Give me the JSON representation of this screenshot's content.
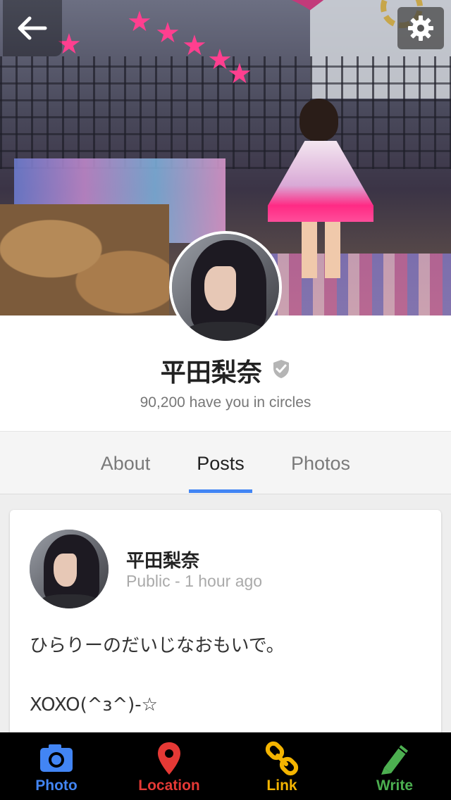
{
  "cover": {
    "icons": {
      "back": "arrow-left-icon",
      "settings": "gear-icon"
    }
  },
  "profile": {
    "name": "平田梨奈",
    "verified_icon": "verified-shield-icon",
    "circles_text": "90,200 have you in circles"
  },
  "tabs": [
    {
      "label": "About",
      "active": false
    },
    {
      "label": "Posts",
      "active": true
    },
    {
      "label": "Photos",
      "active": false
    }
  ],
  "post": {
    "author": "平田梨奈",
    "meta": "Public - 1 hour ago",
    "text_line1": "ひらりーのだいじなおもいで。",
    "text_line2": "XOXO(^з^)-☆"
  },
  "actions": [
    {
      "label": "Photo",
      "icon": "camera-icon",
      "color": "#4285f4"
    },
    {
      "label": "Location",
      "icon": "location-pin-icon",
      "color": "#e53935"
    },
    {
      "label": "Link",
      "icon": "link-icon",
      "color": "#f4b400"
    },
    {
      "label": "Write",
      "icon": "pencil-icon",
      "color": "#4caf50"
    }
  ],
  "colors": {
    "tab_indicator": "#4285f4",
    "bottom_bar": "#000000"
  }
}
